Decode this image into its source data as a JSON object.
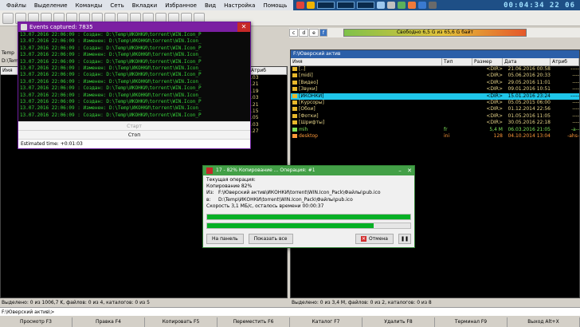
{
  "menu": [
    "Файлы",
    "Выделение",
    "Команды",
    "Сеть",
    "Вкладки",
    "Избранное",
    "Вид",
    "Настройка",
    "Помощь"
  ],
  "clock": "00:04:34 22 06",
  "right_drive": {
    "drives": [
      "c",
      "d",
      "e",
      "f"
    ],
    "selected": "f",
    "free": "Свободно 6,5 G из 65,6 G байт"
  },
  "left_panel": {
    "label": "Temp",
    "path": "D:\\Temp",
    "columns": [
      "Имя",
      "Атриб"
    ],
    "attr_fragments": [
      ".03",
      ".21",
      ".19",
      ".03",
      ".21",
      ".15",
      ".05",
      ".03",
      ".27"
    ],
    "status": "Выделено: 0 из 1006,7 K, файлов: 0 из 4, каталогов: 0 из 5"
  },
  "right_panel": {
    "path": "F:\\Юверский актив",
    "title": "Юверский актив",
    "columns": [
      "Имя",
      "Тип",
      "Размер",
      "Дата",
      "Атриб"
    ],
    "rows": [
      {
        "name": "[..]",
        "type": "",
        "size": "<DIR>",
        "date": "21.06.2016 00:58",
        "attr": "-----"
      },
      {
        "name": "[midi]",
        "type": "",
        "size": "<DIR>",
        "date": "05.06.2016 20:33",
        "attr": "----"
      },
      {
        "name": "[Видео]",
        "type": "",
        "size": "<DIR>",
        "date": "29.05.2016 11:01",
        "attr": "----"
      },
      {
        "name": "[Звуки]",
        "type": "",
        "size": "<DIR>",
        "date": "09.01.2016 10:51",
        "attr": "----"
      },
      {
        "name": "[ИКОНКИ]",
        "type": "",
        "size": "<DIR>",
        "date": "15.01.2016 23:24",
        "attr": "-----"
      },
      {
        "name": "[Курсоры]",
        "type": "",
        "size": "<DIR>",
        "date": "05.05.2015 06:00",
        "attr": "----"
      },
      {
        "name": "[Обои]",
        "type": "",
        "size": "<DIR>",
        "date": "01.12.2014 22:56",
        "attr": "----"
      },
      {
        "name": "[Фотки]",
        "type": "",
        "size": "<DIR>",
        "date": "01.05.2016 11:05",
        "attr": "----"
      },
      {
        "name": "[Шрифты]",
        "type": "",
        "size": "<DIR>",
        "date": "30.05.2016 22:18",
        "attr": "----"
      },
      {
        "name": "mih",
        "type": "fr",
        "size": "5,4 M",
        "date": "06.03.2016 21:05",
        "attr": "-a--"
      },
      {
        "name": "desktop",
        "type": "ini",
        "size": "128",
        "date": "04.10.2014 13:04",
        "attr": "-ahs-"
      }
    ],
    "status": "Выделено: 0 из 3,4 M, файлов: 0 из 2, каталогов: 0 из 8"
  },
  "events_window": {
    "title": "Events captured: 7835",
    "lines": [
      "13.07.2016 22:06:09 : Создан: D:\\Temp\\ИКОНКИ\\torrent\\WIN.Icon_P",
      "13.07.2016 22:06:09 : Изменен: D:\\Temp\\ИКОНКИ\\torrent\\WIN.Icon_",
      "13.07.2016 22:06:09 : Создан: D:\\Temp\\ИКОНКИ\\torrent\\WIN.Icon_P",
      "13.07.2016 22:06:09 : Изменен: D:\\Temp\\ИКОНКИ\\torrent\\WIN.Icon_",
      "13.07.2016 22:06:09 : Создан: D:\\Temp\\ИКОНКИ\\torrent\\WIN.Icon_P",
      "13.07.2016 22:06:09 : Изменен: D:\\Temp\\ИКОНКИ\\torrent\\WIN.Icon_",
      "13.07.2016 22:06:09 : Создан: D:\\Temp\\ИКОНКИ\\torrent\\WIN.Icon_P",
      "13.07.2016 22:06:09 : Изменен: D:\\Temp\\ИКОНКИ\\torrent\\WIN.Icon_",
      "13.07.2016 22:06:09 : Создан: D:\\Temp\\ИКОНКИ\\torrent\\WIN.Icon_P",
      "13.07.2016 22:06:09 : Изменен: D:\\Temp\\ИКОНКИ\\torrent\\WIN.Icon_",
      "13.07.2016 22:06:09 : Создан: D:\\Temp\\ИКОНКИ\\torrent\\WIN.Icon_P",
      "13.07.2016 22:06:09 : Изменен: D:\\Temp\\ИКОНКИ\\torrent\\WIN.Icon_",
      "13.07.2016 22:06:09 : Создан: D:\\Temp\\ИКОНКИ\\torrent\\WIN.Icon_P"
    ],
    "start_label": "Старт",
    "stop_label": "Стоп",
    "estimated": "Estimated time: +0:01:03"
  },
  "copy_dialog": {
    "title": "17 - 82% Копирование ... Операция: #1",
    "current_op": "Текущая операция:",
    "percent_text": "Копирование 82%",
    "from_label": "Из:",
    "from": "F:\\Юверский актив\\ИКОНКИ\\torrent\\WIN.Icon_Pack\\Файлы\\pub.ico",
    "to_label": "в:",
    "to": "D:\\Temp\\ИКОНКИ\\torrent\\WIN.Icon_Pack\\Файлы\\pub.ico",
    "speed": "Скорость 3,1 МБ/с, осталось времени 00:00:37",
    "file_progress": 1.0,
    "total_progress": 0.82,
    "btn_panel": "На панель",
    "btn_show_all": "Показать все",
    "btn_cancel": "Отмена"
  },
  "cmdline": "F:\\Юверский актив\\>",
  "fkeys": [
    "Просмотр F3",
    "Правка F4",
    "Копировать F5",
    "Переместить F6",
    "Каталог F7",
    "Удалить F8",
    "Терминал F9",
    "Выход Alt+X"
  ]
}
